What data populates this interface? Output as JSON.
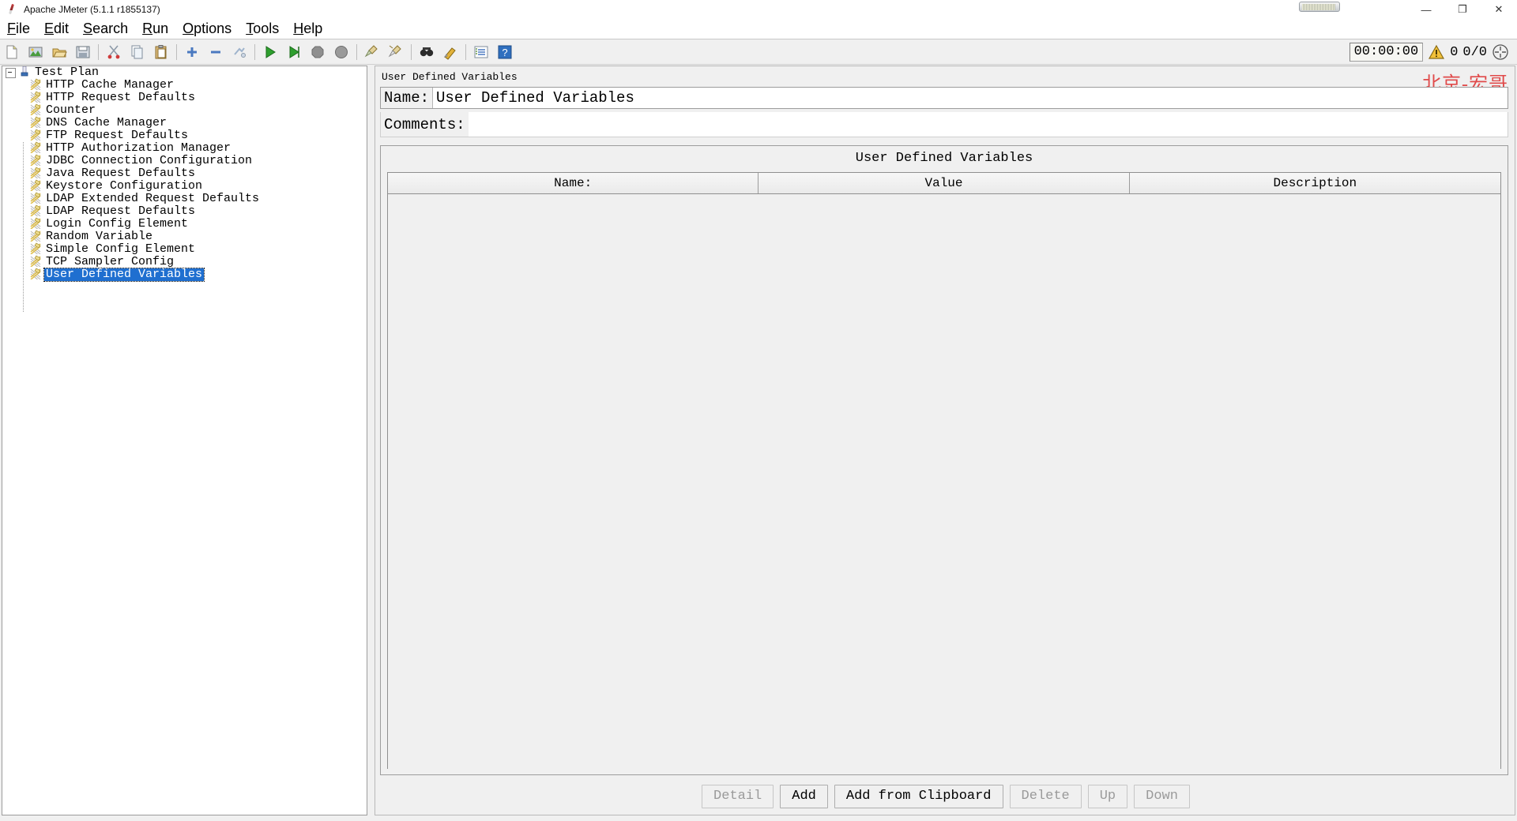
{
  "window": {
    "title": "Apache JMeter (5.1.1 r1855137)",
    "app_icon": "jmeter-feather-icon",
    "minimize_label": "—",
    "maximize_label": "❐",
    "close_label": "✕",
    "memory_widget_name": "memory-usage-meter"
  },
  "menubar": {
    "items": [
      {
        "mnemonic": "F",
        "rest": "ile"
      },
      {
        "mnemonic": "E",
        "rest": "dit"
      },
      {
        "mnemonic": "S",
        "rest": "earch"
      },
      {
        "mnemonic": "R",
        "rest": "un"
      },
      {
        "mnemonic": "O",
        "rest": "ptions"
      },
      {
        "mnemonic": "T",
        "rest": "ools"
      },
      {
        "mnemonic": "H",
        "rest": "elp"
      }
    ]
  },
  "toolbar": {
    "buttons": [
      {
        "name": "new-icon",
        "title": "New"
      },
      {
        "name": "templates-icon",
        "title": "Templates"
      },
      {
        "name": "open-icon",
        "title": "Open"
      },
      {
        "name": "save-icon",
        "title": "Save"
      },
      {
        "name": "cut-icon",
        "title": "Cut"
      },
      {
        "name": "copy-icon",
        "title": "Copy"
      },
      {
        "name": "paste-icon",
        "title": "Paste"
      },
      {
        "name": "expand-all-icon",
        "title": "Expand All"
      },
      {
        "name": "collapse-all-icon",
        "title": "Collapse All"
      },
      {
        "name": "toggle-icon",
        "title": "Toggle"
      },
      {
        "name": "start-icon",
        "title": "Start"
      },
      {
        "name": "start-no-pauses-icon",
        "title": "Start no pauses"
      },
      {
        "name": "stop-icon",
        "title": "Stop"
      },
      {
        "name": "shutdown-icon",
        "title": "Shutdown"
      },
      {
        "name": "clear-icon",
        "title": "Clear"
      },
      {
        "name": "clear-all-icon",
        "title": "Clear All"
      },
      {
        "name": "search-icon",
        "title": "Search"
      },
      {
        "name": "search-reset-icon",
        "title": "Reset Search"
      },
      {
        "name": "function-helper-icon",
        "title": "Function Helper Dialog"
      },
      {
        "name": "help-icon",
        "title": "Help"
      }
    ]
  },
  "status": {
    "elapsed_time": "00:00:00",
    "warning_icon": "warning-triangle-icon",
    "warning_count": "0",
    "threads_running": "0/0",
    "expand_icon": "expand-collapse-icon"
  },
  "tree": {
    "root": {
      "label": "Test Plan",
      "icon": "test-plan-icon",
      "expanded": true
    },
    "children": [
      {
        "label": "HTTP Cache Manager",
        "icon": "config-element-icon",
        "selected": false
      },
      {
        "label": "HTTP Request Defaults",
        "icon": "config-element-icon",
        "selected": false
      },
      {
        "label": "Counter",
        "icon": "config-element-icon",
        "selected": false
      },
      {
        "label": "DNS Cache Manager",
        "icon": "config-element-icon",
        "selected": false
      },
      {
        "label": "FTP Request Defaults",
        "icon": "config-element-icon",
        "selected": false
      },
      {
        "label": "HTTP Authorization Manager",
        "icon": "config-element-icon",
        "selected": false
      },
      {
        "label": "JDBC Connection Configuration",
        "icon": "config-element-icon",
        "selected": false
      },
      {
        "label": "Java Request Defaults",
        "icon": "config-element-icon",
        "selected": false
      },
      {
        "label": "Keystore Configuration",
        "icon": "config-element-icon",
        "selected": false
      },
      {
        "label": "LDAP Extended Request Defaults",
        "icon": "config-element-icon",
        "selected": false
      },
      {
        "label": "LDAP Request Defaults",
        "icon": "config-element-icon",
        "selected": false
      },
      {
        "label": "Login Config Element",
        "icon": "config-element-icon",
        "selected": false
      },
      {
        "label": "Random Variable",
        "icon": "config-element-icon",
        "selected": false
      },
      {
        "label": "Simple Config Element",
        "icon": "config-element-icon",
        "selected": false
      },
      {
        "label": "TCP Sampler Config",
        "icon": "config-element-icon",
        "selected": false
      },
      {
        "label": "User Defined Variables",
        "icon": "config-element-icon",
        "selected": true
      }
    ]
  },
  "panel": {
    "header": "User Defined Variables",
    "watermark": "北京-宏哥",
    "name_label": "Name:",
    "name_value": "User Defined Variables",
    "name_placeholder": "",
    "comments_label": "Comments:",
    "comments_value": "",
    "comments_placeholder": ""
  },
  "variables_table": {
    "caption": "User Defined Variables",
    "columns": [
      "Name:",
      "Value",
      "Description"
    ],
    "rows": []
  },
  "buttons": [
    {
      "label": "Detail",
      "enabled": false
    },
    {
      "label": "Add",
      "enabled": true
    },
    {
      "label": "Add from Clipboard",
      "enabled": true
    },
    {
      "label": "Delete",
      "enabled": false
    },
    {
      "label": "Up",
      "enabled": false
    },
    {
      "label": "Down",
      "enabled": false
    }
  ],
  "colors": {
    "selection_blue": "#1f6fd0",
    "panel_gray": "#f0f0f0",
    "watermark_red": "#e04a4a",
    "play_green": "#2e9f2e"
  }
}
